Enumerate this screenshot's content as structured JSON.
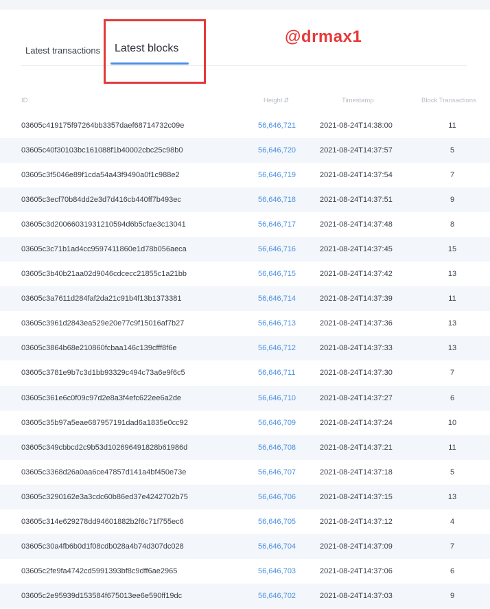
{
  "tabs": {
    "transactions_label": "Latest transactions",
    "blocks_label": "Latest blocks"
  },
  "watermark": "@drmax1",
  "columns": {
    "id": "ID",
    "height": "Height",
    "height_sort_icon": "sort-icon",
    "timestamp": "Timestamp",
    "block_transactions": "Block Transactions"
  },
  "rows": [
    {
      "id": "03605c419175f97264bb3357daef68714732c09e",
      "height": "56,646,721",
      "timestamp": "2021-08-24T14:38:00",
      "tx": "11"
    },
    {
      "id": "03605c40f30103bc161088f1b40002cbc25c98b0",
      "height": "56,646,720",
      "timestamp": "2021-08-24T14:37:57",
      "tx": "5"
    },
    {
      "id": "03605c3f5046e89f1cda54a43f9490a0f1c988e2",
      "height": "56,646,719",
      "timestamp": "2021-08-24T14:37:54",
      "tx": "7"
    },
    {
      "id": "03605c3ecf70b84dd2e3d7d416cb440ff7b493ec",
      "height": "56,646,718",
      "timestamp": "2021-08-24T14:37:51",
      "tx": "9"
    },
    {
      "id": "03605c3d2006603193121059 4d6b5cfae3c13041",
      "height": "56,646,717",
      "timestamp": "2021-08-24T14:37:48",
      "tx": "8"
    },
    {
      "id": "03605c3c71b1ad4cc9597411860e1d78b056aeca",
      "height": "56,646,716",
      "timestamp": "2021-08-24T14:37:45",
      "tx": "15"
    },
    {
      "id": "03605c3b40b21aa02d9046cdcecc21855c1a21bb",
      "height": "56,646,715",
      "timestamp": "2021-08-24T14:37:42",
      "tx": "13"
    },
    {
      "id": "03605c3a7611d284faf2da21c91b4f13b1373381",
      "height": "56,646,714",
      "timestamp": "2021-08-24T14:37:39",
      "tx": "11"
    },
    {
      "id": "03605c3961d2843ea529e20e77c9f15016af7b27",
      "height": "56,646,713",
      "timestamp": "2021-08-24T14:37:36",
      "tx": "13"
    },
    {
      "id": "03605c3864b68e210860fcbaa146c139cfff8f6e",
      "height": "56,646,712",
      "timestamp": "2021-08-24T14:37:33",
      "tx": "13"
    },
    {
      "id": "03605c3781e9b7c3d1bb93329c494c73a6e9f6c5",
      "height": "56,646,711",
      "timestamp": "2021-08-24T14:37:30",
      "tx": "7"
    },
    {
      "id": "03605c361e6c0f09c97d2e8a3f4efc622ee6a2de",
      "height": "56,646,710",
      "timestamp": "2021-08-24T14:37:27",
      "tx": "6"
    },
    {
      "id": "03605c35b97a5eae687957191dad6a1835e0cc92",
      "height": "56,646,709",
      "timestamp": "2021-08-24T14:37:24",
      "tx": "10"
    },
    {
      "id": "03605c349cbbcd2c9b53d102696491828b61986d",
      "height": "56,646,708",
      "timestamp": "2021-08-24T14:37:21",
      "tx": "11"
    },
    {
      "id": "03605c3368d26a0aa6ce47857d141a4bf450e73e",
      "height": "56,646,707",
      "timestamp": "2021-08-24T14:37:18",
      "tx": "5"
    },
    {
      "id": "03605c3290162e3a3cdc60b86ed37e4242702b75",
      "height": "56,646,706",
      "timestamp": "2021-08-24T14:37:15",
      "tx": "13"
    },
    {
      "id": "03605c314e629278dd94601882b2f6c71f755ec6",
      "height": "56,646,705",
      "timestamp": "2021-08-24T14:37:12",
      "tx": "4"
    },
    {
      "id": "03605c30a4fb6b0d1f08cdb028a4b74d307dc028",
      "height": "56,646,704",
      "timestamp": "2021-08-24T14:37:09",
      "tx": "7"
    },
    {
      "id": "03605c2fe9fa4742cd5991393bf8c9dff6ae2965",
      "height": "56,646,703",
      "timestamp": "2021-08-24T14:37:06",
      "tx": "6"
    },
    {
      "id": "03605c2e95939d153584f675013ee6e590ff19dc",
      "height": "56,646,702",
      "timestamp": "2021-08-24T14:37:03",
      "tx": "9"
    }
  ],
  "colors": {
    "accent": "#4a90e2",
    "highlight": "#e2393b",
    "row_alt": "#f3f6fa"
  }
}
